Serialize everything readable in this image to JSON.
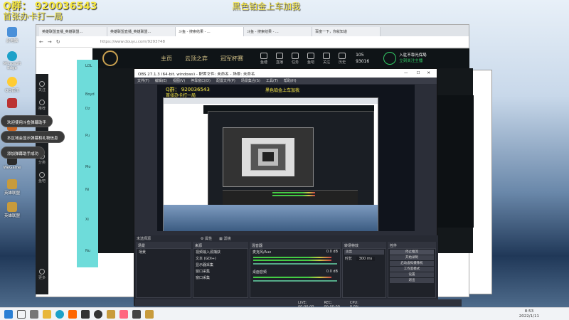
{
  "overlay": {
    "qq": "Q群： 920036543",
    "line2": "首张办卡打一局",
    "center": "黑色铂金上车加我"
  },
  "desktop_icons": [
    {
      "label": "此电脑",
      "color": "#4a90d9"
    },
    {
      "label": "Microsoft Edge",
      "color": "#1da1c9"
    },
    {
      "label": "QQ音乐",
      "color": "#ffcc33"
    },
    {
      "label": "",
      "color": "#bb3333"
    },
    {
      "label": "",
      "color": "#cc6622"
    },
    {
      "label": "WeGame",
      "color": "#2b2b2b"
    },
    {
      "label": "英雄联盟",
      "color": "#c89b3c"
    },
    {
      "label": "英雄联盟",
      "color": "#c89b3c"
    }
  ],
  "notifications": [
    "欢迎使用斗鱼弹幕助手",
    "本区域会显示弹幕和礼物信息",
    "添加弹幕助手成功"
  ],
  "browser": {
    "tabs": [
      "英雄联盟直播_英雄联盟...",
      "英雄联盟直播_英雄联盟...",
      "斗鱼 - 搜索结果 - ...",
      "斗鱼 - 搜索结果 - ...",
      "百度一下，你就知道"
    ],
    "url": "https://www.douyu.com/9293748"
  },
  "douyu": {
    "nav": [
      "主页",
      "云顶之弈",
      "冠军杯赛"
    ],
    "icons": [
      "鱼塘",
      "直播",
      "任务",
      "鱼吧",
      "关注",
      "历史"
    ],
    "stats": [
      "105",
      "93016"
    ],
    "promo": "入驻不靠光保局",
    "promo_sub": "立刻关注主播"
  },
  "sidebar": [
    "关注",
    "推荐",
    "分类",
    "鱼吧",
    "更多"
  ],
  "cyan_labels": [
    "LOL",
    "Boyd",
    "Dz",
    "Pu",
    "Mo",
    "Ni",
    "Xi",
    "Nu"
  ],
  "obs": {
    "title": "OBS 27.1.3 (64-bit, windows) - 配置文件: 未命名 - 场景: 未命名",
    "menu": [
      "文件(F)",
      "编辑(E)",
      "视图(V)",
      "停靠窗口(D)",
      "配置文件(P)",
      "场景集合(S)",
      "工具(T)",
      "帮助(H)"
    ],
    "tabs": [
      "属性",
      "滤镜"
    ],
    "docks": [
      "场景",
      "来源",
      "混音器",
      "转场特效",
      "控件"
    ],
    "scenes": [
      "场景"
    ],
    "sources": [
      "视频输入源捕获",
      "文本 (GDI+)",
      "显示器采集",
      "窗口采集",
      "窗口采集"
    ],
    "mixer": [
      {
        "name": "麦克风/Aux",
        "db": "0.0 dB"
      },
      {
        "name": "桌面音频",
        "db": "0.0 dB"
      }
    ],
    "transition": {
      "type": "淡出",
      "duration_label": "时长",
      "duration": "300 ms"
    },
    "controls": [
      "停止推流",
      "开始录制",
      "启动虚拟摄像机",
      "工作室模式",
      "设置",
      "退出"
    ],
    "status": [
      "LIVE: 00:00:00",
      "REC: 00:00:00",
      "CPU: 0.0%, 60.00 fps"
    ],
    "preview_label": "未选择源"
  },
  "taskbar": {
    "time": "8:53",
    "date": "2022/1/11"
  }
}
